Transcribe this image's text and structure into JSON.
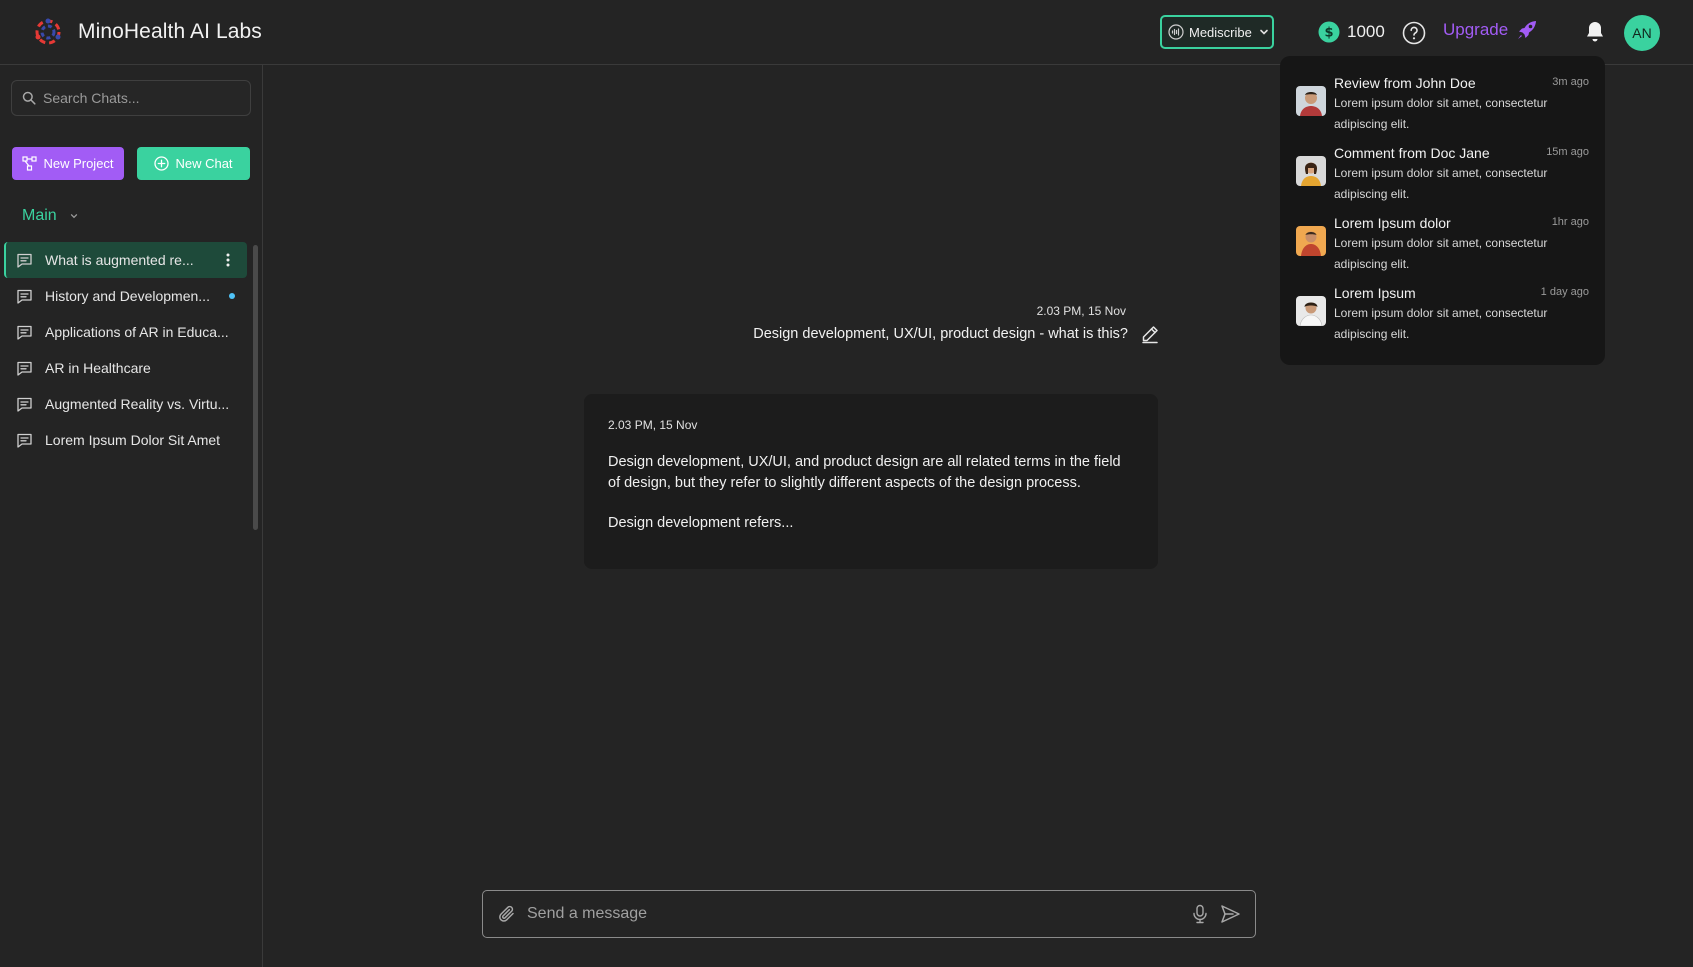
{
  "app": {
    "title": "MinoHealth AI Labs"
  },
  "header": {
    "model_select": "Mediscribe",
    "credits": "1000",
    "upgrade_label": "Upgrade",
    "avatar_initials": "AN",
    "colors": {
      "accent_green": "#3ad29f",
      "accent_purple": "#a25cf5"
    }
  },
  "sidebar": {
    "search_placeholder": "Search Chats...",
    "new_project_label": "New Project",
    "new_chat_label": "New Chat",
    "section_label": "Main",
    "chats": [
      {
        "label": "What is augmented re...",
        "active": true
      },
      {
        "label": "History and Developmen...",
        "unread": true
      },
      {
        "label": "Applications of AR in Educa..."
      },
      {
        "label": "AR in Healthcare"
      },
      {
        "label": "Augmented Reality vs. Virtu..."
      },
      {
        "label": "Lorem Ipsum Dolor Sit Amet"
      }
    ]
  },
  "conversation": {
    "user_message": {
      "time": "2.03 PM, 15 Nov",
      "text": "Design development, UX/UI, product design - what is this?"
    },
    "ai_message": {
      "time": "2.03 PM, 15 Nov",
      "paragraph_1": "Design development, UX/UI, and product design are all related terms in the field of design, but they refer to slightly different aspects of the design process.",
      "paragraph_2": "Design development refers..."
    }
  },
  "composer": {
    "placeholder": "Send a message"
  },
  "notifications": [
    {
      "title": "Review from John Doe",
      "time": "3m ago",
      "body": "Lorem ipsum dolor sit amet, consectetur adipiscing elit."
    },
    {
      "title": "Comment from Doc Jane",
      "time": "15m ago",
      "body": "Lorem ipsum dolor sit amet, consectetur adipiscing elit."
    },
    {
      "title": "Lorem Ipsum dolor",
      "time": "1hr ago",
      "body": "Lorem ipsum dolor sit amet, consectetur adipiscing elit."
    },
    {
      "title": "Lorem Ipsum",
      "time": "1 day ago",
      "body": "Lorem ipsum dolor sit amet, consectetur adipiscing elit."
    }
  ],
  "icons": [
    "logo-icon",
    "waveform-icon",
    "chevron-down-icon",
    "dollar-coin-icon",
    "help-icon",
    "rocket-icon",
    "bell-icon",
    "search-icon",
    "project-icon",
    "plus-circle-icon",
    "chat-bubble-icon",
    "more-vertical-icon",
    "edit-icon",
    "paperclip-icon",
    "microphone-icon",
    "send-icon"
  ]
}
